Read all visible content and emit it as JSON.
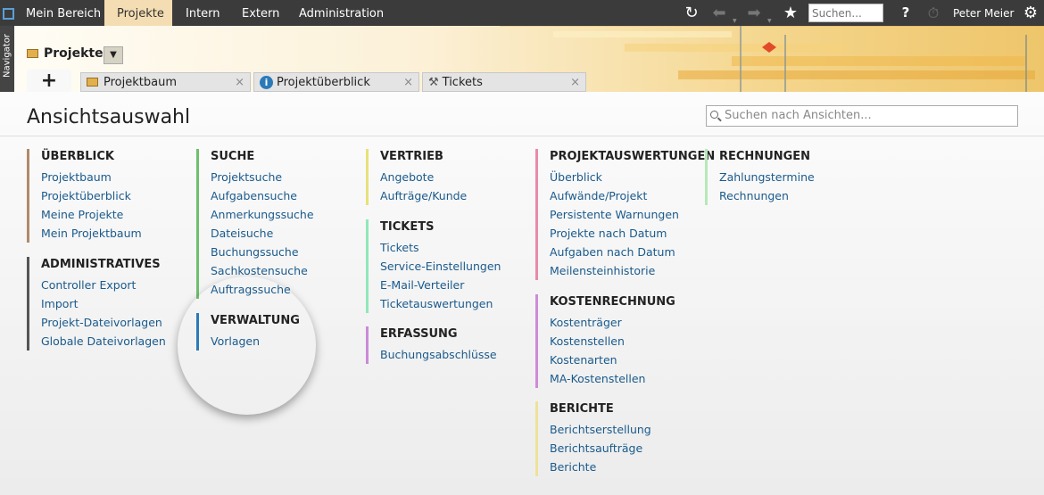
{
  "topbar": {
    "nav": [
      "Mein Bereich",
      "Projekte",
      "Intern",
      "Extern",
      "Administration"
    ],
    "search_placeholder": "Suchen...",
    "user": "Peter Meier",
    "help": "?"
  },
  "navigator": {
    "label": "Navigator"
  },
  "project": {
    "title": "Projekte",
    "tabs": [
      {
        "label": "Projektbaum",
        "icon": "folder-icon"
      },
      {
        "label": "Projektüberblick",
        "icon": "info-icon"
      },
      {
        "label": "Tickets",
        "icon": "tools-icon"
      }
    ],
    "add_tab": "+"
  },
  "main": {
    "title": "Ansichtsauswahl",
    "search_placeholder": "Suchen nach Ansichten..."
  },
  "groups": [
    {
      "title": "ÜBERBLICK",
      "color": "#b08a6a",
      "items": [
        "Projektbaum",
        "Projektüberblick",
        "Meine Projekte",
        "Mein Projektbaum"
      ]
    },
    {
      "title": "ADMINISTRATIVES",
      "color": "#555555",
      "items": [
        "Controller Export",
        "Import",
        "Projekt-Dateivorlagen",
        "Globale Dateivorlagen"
      ]
    },
    {
      "title": "SUCHE",
      "color": "#6fbf6f",
      "items": [
        "Projektsuche",
        "Aufgabensuche",
        "Anmerkungssuche",
        "Dateisuche",
        "Buchungssuche",
        "Sachkostensuche",
        "Auftragssuche"
      ]
    },
    {
      "title": "VERWALTUNG",
      "color": "#2a7ab8",
      "items": [
        "Vorlagen"
      ]
    },
    {
      "title": "VERTRIEB",
      "color": "#e6e27a",
      "items": [
        "Angebote",
        "Aufträge/Kunde"
      ]
    },
    {
      "title": "TICKETS",
      "color": "#8fe8b8",
      "items": [
        "Tickets",
        "Service-Einstellungen",
        "E-Mail-Verteiler",
        "Ticketauswertungen"
      ]
    },
    {
      "title": "ERFASSUNG",
      "color": "#c98ad8",
      "items": [
        "Buchungsabschlüsse"
      ]
    },
    {
      "title": "PROJEKTAUSWERTUNGEN",
      "color": "#e88aa8",
      "items": [
        "Überblick",
        "Aufwände/Projekt",
        "Persistente Warnungen",
        "Projekte nach Datum",
        "Aufgaben nach Datum",
        "Meilensteinhistorie"
      ]
    },
    {
      "title": "KOSTENRECHNUNG",
      "color": "#cf8ad8",
      "items": [
        "Kostenträger",
        "Kostenstellen",
        "Kostenarten",
        "MA-Kostenstellen"
      ]
    },
    {
      "title": "BERICHTE",
      "color": "#eee29a",
      "items": [
        "Berichtserstellung",
        "Berichtsaufträge",
        "Berichte"
      ]
    },
    {
      "title": "RECHNUNGEN",
      "color": "#b8e8b8",
      "items": [
        "Zahlungstermine",
        "Rechnungen"
      ]
    }
  ]
}
